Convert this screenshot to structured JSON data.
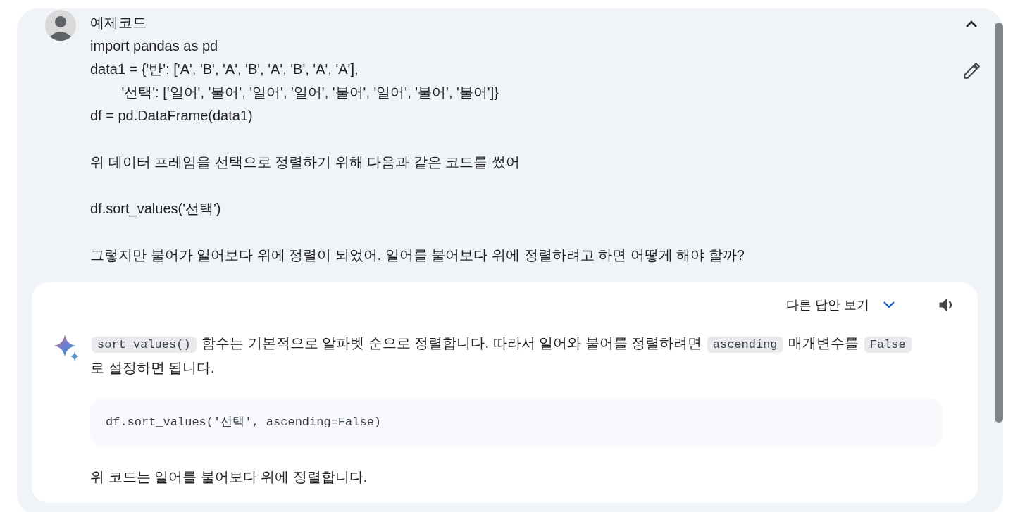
{
  "prompt": {
    "paragraphs": [
      [
        "예제코드",
        "import pandas as pd",
        "data1 = {'반': ['A', 'B', 'A', 'B', 'A', 'B', 'A', 'A'],",
        "        '선택': ['일어', '불어', '일어', '일어', '불어', '일어', '불어', '불어']}",
        "df = pd.DataFrame(data1)"
      ],
      [
        "위 데이터 프레임을 선택으로 정렬하기 위해 다음과 같은 코드를 썼어"
      ],
      [
        "df.sort_values('선택')"
      ],
      [
        "그렇지만 불어가 일어보다 위에 정렬이 되었어. 일어를 불어보다 위에 정렬하려고 하면 어떻게 해야 할까?"
      ]
    ]
  },
  "response": {
    "drafts_label": "다른 답안 보기",
    "blocks": [
      {
        "kind": "paragraph",
        "segments": [
          {
            "kind": "code",
            "text": "sort_values()"
          },
          {
            "kind": "text",
            "text": " 함수는 기본적으로 알파벳 순으로 정렬합니다. 따라서 일어와 불어를 정렬하려면 "
          },
          {
            "kind": "code",
            "text": "ascending"
          },
          {
            "kind": "text",
            "text": " 매개변수를 "
          },
          {
            "kind": "code",
            "text": "False"
          },
          {
            "kind": "text",
            "text": "로 설정하면 됩니다."
          }
        ]
      },
      {
        "kind": "codeblock",
        "text": "df.sort_values('선택', ascending=False)"
      },
      {
        "kind": "paragraph",
        "segments": [
          {
            "kind": "text",
            "text": "위 코드는 일어를 불어보다 위에 정렬합니다."
          }
        ]
      }
    ]
  }
}
